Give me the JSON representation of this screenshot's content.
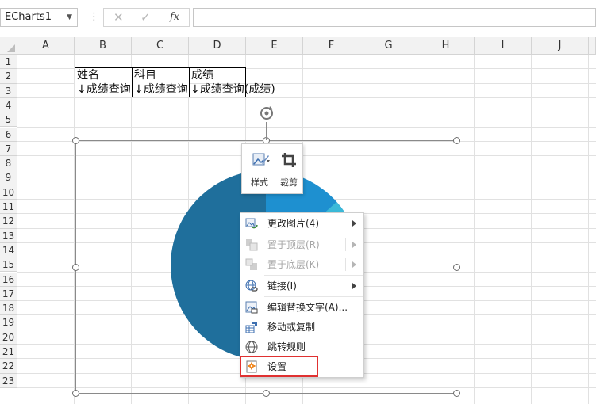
{
  "formula_bar": {
    "name_box": "ECharts1",
    "name_box_arrow": "▼",
    "separator": "⋮",
    "cancel_glyph": "✕",
    "confirm_glyph": "✓",
    "fx_label": "fx",
    "formula_value": ""
  },
  "columns": [
    "A",
    "B",
    "C",
    "D",
    "E",
    "F",
    "G",
    "H",
    "I",
    "J"
  ],
  "rows": [
    "1",
    "2",
    "3",
    "4",
    "5",
    "6",
    "7",
    "8",
    "9",
    "10",
    "11",
    "12",
    "13",
    "14",
    "15",
    "16",
    "17",
    "18",
    "19",
    "20",
    "21",
    "22",
    "23"
  ],
  "table": {
    "headers": [
      "姓名",
      "科目",
      "成绩"
    ],
    "values": [
      "↓成绩查询",
      "↓成绩查询",
      "↓成绩查询(成绩)"
    ]
  },
  "chart": {
    "dark_color": "#1f6f9c",
    "light_color": "#1e90d0",
    "accent_color": "#3bb9d8"
  },
  "mini_toolbar": {
    "style_label": "样式",
    "crop_label": "裁剪",
    "style_icon": "paint-picture-icon",
    "crop_icon": "crop-icon"
  },
  "context_menu": {
    "items": [
      {
        "label": "更改图片(4)",
        "icon": "change-picture-icon",
        "submenu": true,
        "enabled": true
      },
      {
        "label": "置于顶层(R)",
        "icon": "bring-to-front-icon",
        "submenu": true,
        "enabled": false
      },
      {
        "label": "置于底层(K)",
        "icon": "send-to-back-icon",
        "submenu": true,
        "enabled": false
      },
      {
        "label": "链接(I)",
        "icon": "link-icon",
        "submenu": true,
        "enabled": true
      },
      {
        "label": "编辑替换文字(A)...",
        "icon": "alt-text-icon",
        "submenu": false,
        "enabled": true
      },
      {
        "label": "移动或复制",
        "icon": "move-copy-icon",
        "submenu": false,
        "enabled": true
      },
      {
        "label": "跳转规则",
        "icon": "globe-icon",
        "submenu": false,
        "enabled": true
      },
      {
        "label": "设置",
        "icon": "settings-icon",
        "submenu": false,
        "enabled": true
      }
    ]
  },
  "highlight_color": "#e03131"
}
